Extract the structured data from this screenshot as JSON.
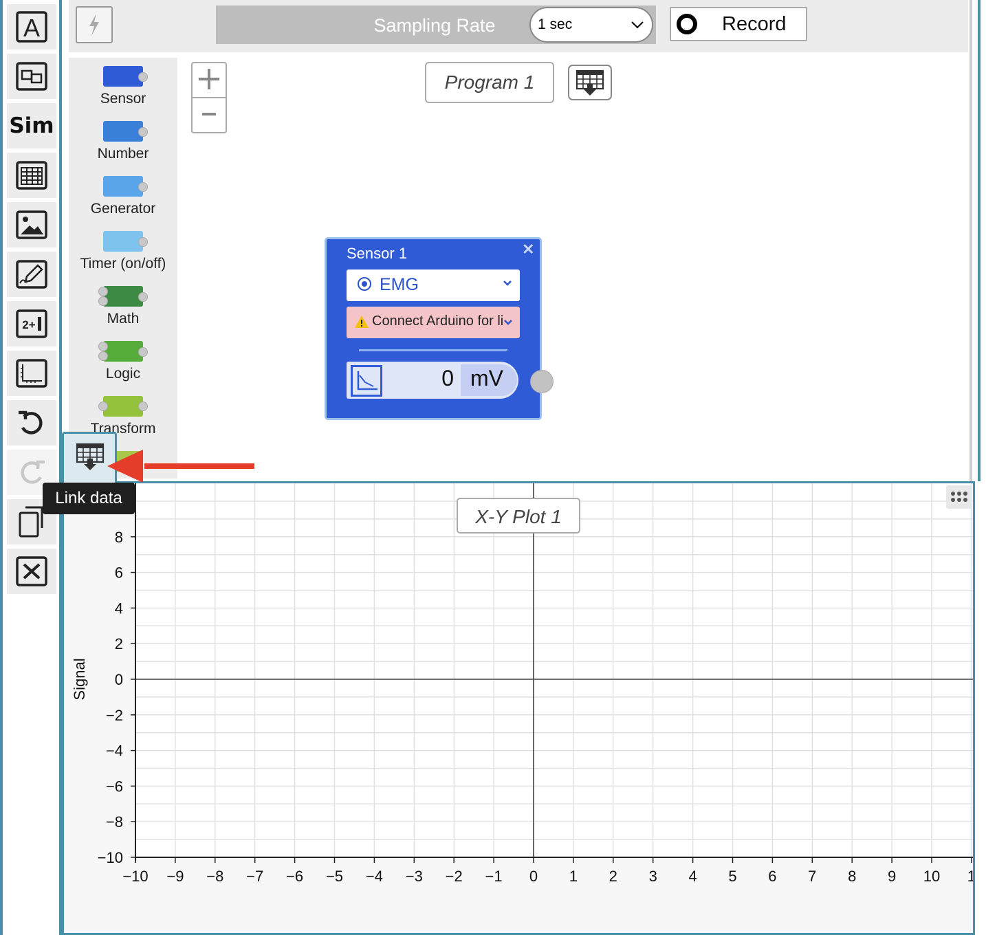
{
  "toolbar": {
    "sim_label": "Sim",
    "tools": [
      "text-tool",
      "link-tool",
      "sim-tool",
      "table-tool",
      "image-tool",
      "drawing-tool",
      "expression-tool",
      "graph-tool",
      "undo-tool",
      "redo-tool",
      "duplicate-tool",
      "delete-tool"
    ]
  },
  "topbar": {
    "sampling_label": "Sampling Rate",
    "sampling_value": "1 sec",
    "record_label": "Record"
  },
  "palette": {
    "items": [
      {
        "label": "Sensor",
        "color": "#2f5bd6"
      },
      {
        "label": "Number",
        "color": "#3a80d9"
      },
      {
        "label": "Generator",
        "color": "#5aa5ea"
      },
      {
        "label": "Timer (on/off)",
        "color": "#7ec2ee"
      },
      {
        "label": "Math",
        "color": "#3d8a44"
      },
      {
        "label": "Logic",
        "color": "#56ac3a"
      },
      {
        "label": "Transform",
        "color": "#95c23d"
      }
    ]
  },
  "program": {
    "title": "Program 1"
  },
  "sensor_node": {
    "title": "Sensor 1",
    "type": "EMG",
    "warning": "Connect Arduino for li",
    "value": "0",
    "unit": "mV"
  },
  "plot": {
    "title": "X-Y Plot 1",
    "tooltip": "Link data"
  },
  "chart_data": {
    "type": "scatter",
    "title": "X-Y Plot 1",
    "xlabel": "",
    "ylabel": "Signal",
    "xlim": [
      -10,
      11
    ],
    "ylim": [
      -10,
      10
    ],
    "xticks": [
      "−10",
      "−9",
      "−8",
      "−7",
      "−6",
      "−5",
      "−4",
      "−3",
      "−2",
      "−1",
      "0",
      "1",
      "2",
      "3",
      "4",
      "5",
      "6",
      "7",
      "8",
      "9",
      "10",
      "1"
    ],
    "yticks": [
      "8",
      "6",
      "4",
      "2",
      "0",
      "−2",
      "−4",
      "−6",
      "−8",
      "−10"
    ],
    "grid": true,
    "series": []
  }
}
